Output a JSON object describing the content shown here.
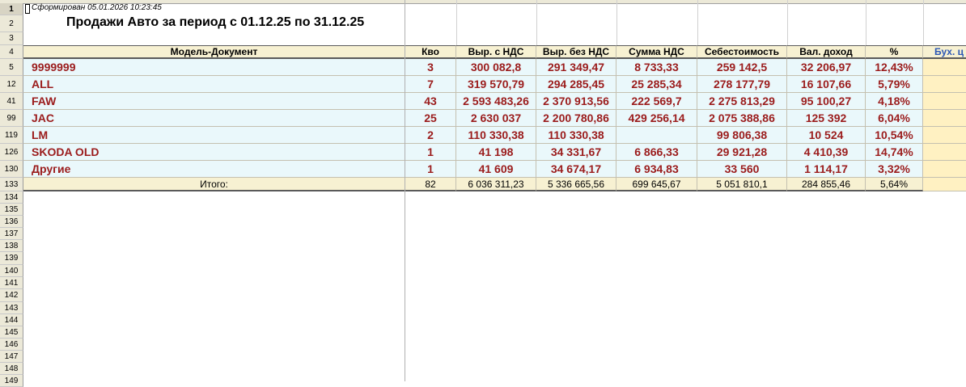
{
  "sheet": {
    "created_label": "Сформирован 05.01.2026 10:23:45",
    "title": "Продажи Авто за период с 01.12.25 по  31.12.25"
  },
  "row_headers": [
    "1",
    "2",
    "3",
    "4",
    "5",
    "12",
    "41",
    "99",
    "119",
    "126",
    "130",
    "133",
    "134",
    "135",
    "136",
    "137",
    "138",
    "139",
    "140",
    "141",
    "142",
    "143",
    "144",
    "145",
    "146",
    "147",
    "148",
    "149"
  ],
  "table": {
    "columns": [
      "Модель-Документ",
      "Кво",
      "Выр. с НДС",
      "Выр. без НДС",
      "Сумма НДС",
      "Себестоимость",
      "Вал. доход",
      "%",
      "Бух. ц"
    ],
    "rows": [
      {
        "name": "9999999",
        "qty": "3",
        "rev_vat": "300 082,8",
        "rev_novat": "291 349,47",
        "vat": "8 733,33",
        "cost": "259 142,5",
        "gross": "32 206,97",
        "pct": "12,43%"
      },
      {
        "name": "ALL",
        "qty": "7",
        "rev_vat": "319 570,79",
        "rev_novat": "294 285,45",
        "vat": "25 285,34",
        "cost": "278 177,79",
        "gross": "16 107,66",
        "pct": "5,79%"
      },
      {
        "name": "FAW",
        "qty": "43",
        "rev_vat": "2 593 483,26",
        "rev_novat": "2 370 913,56",
        "vat": "222 569,7",
        "cost": "2 275 813,29",
        "gross": "95 100,27",
        "pct": "4,18%"
      },
      {
        "name": "JAC",
        "qty": "25",
        "rev_vat": "2 630 037",
        "rev_novat": "2 200 780,86",
        "vat": "429 256,14",
        "cost": "2 075 388,86",
        "gross": "125 392",
        "pct": "6,04%"
      },
      {
        "name": "LM",
        "qty": "2",
        "rev_vat": "110 330,38",
        "rev_novat": "110 330,38",
        "vat": "",
        "cost": "99 806,38",
        "gross": "10 524",
        "pct": "10,54%"
      },
      {
        "name": "SKODA OLD",
        "qty": "1",
        "rev_vat": "41 198",
        "rev_novat": "34 331,67",
        "vat": "6 866,33",
        "cost": "29 921,28",
        "gross": "4 410,39",
        "pct": "14,74%"
      },
      {
        "name": "Другие",
        "qty": "1",
        "rev_vat": "41 609",
        "rev_novat": "34 674,17",
        "vat": "6 934,83",
        "cost": "33 560",
        "gross": "1 114,17",
        "pct": "3,32%"
      }
    ],
    "total": {
      "label": "Итого:",
      "qty": "82",
      "rev_vat": "6 036 311,23",
      "rev_novat": "5 336 665,56",
      "vat": "699 645,67",
      "cost": "5 051 810,1",
      "gross": "284 855,46",
      "pct": "5,64%"
    }
  },
  "colors": {
    "header_bg": "#f7f1d2",
    "row_bg": "#eaf8fb",
    "value_text": "#9b1c1c",
    "accent_col": "#fff1c2",
    "link_col": "#2b57b5"
  }
}
